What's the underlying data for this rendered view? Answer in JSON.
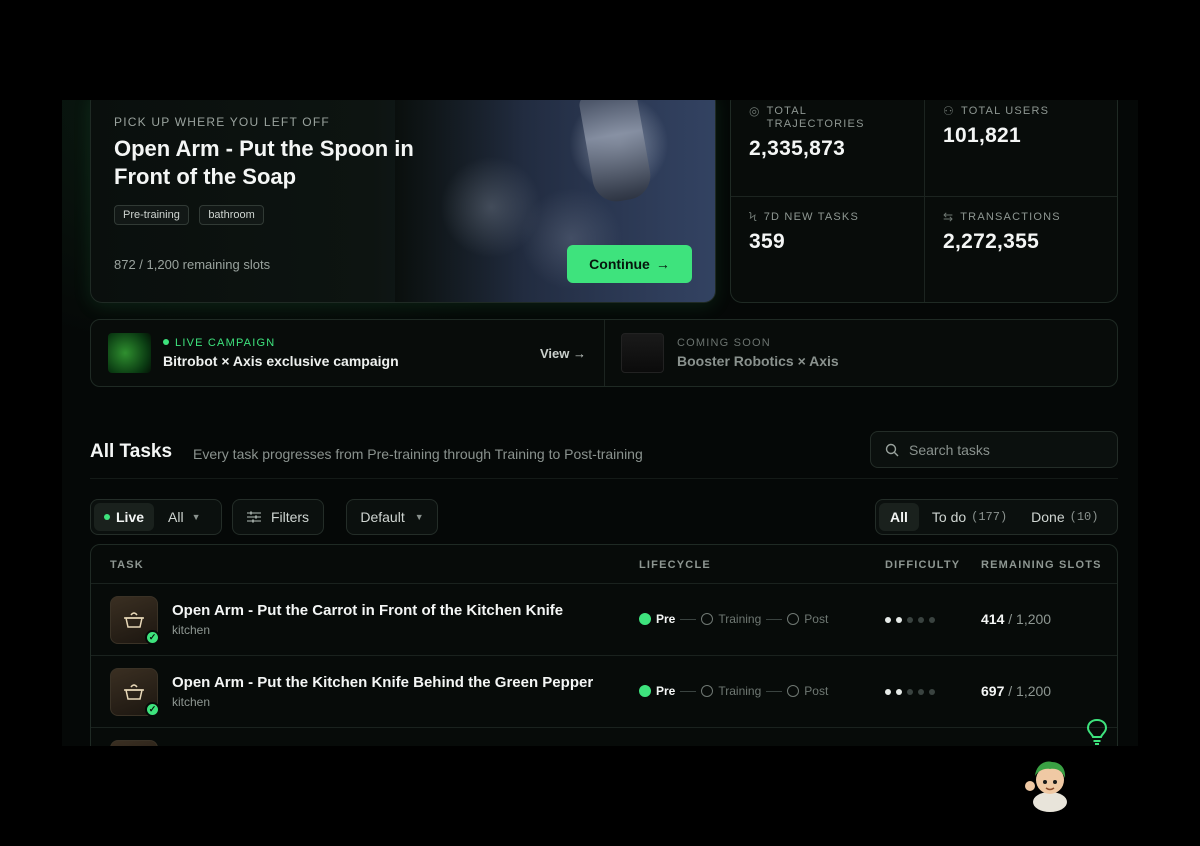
{
  "hero": {
    "kicker": "PICK UP WHERE YOU LEFT OFF",
    "title": "Open Arm - Put the Spoon in Front of the Soap",
    "tags": [
      "Pre-training",
      "bathroom"
    ],
    "slots": "872 / 1,200 remaining slots",
    "continue_label": "Continue",
    "continue_arrow": "→"
  },
  "stats": [
    {
      "icon": "target-icon",
      "glyph": "◎",
      "label": "TOTAL TRAJECTORIES",
      "value": "2,335,873"
    },
    {
      "icon": "users-icon",
      "glyph": "⚇",
      "label": "TOTAL USERS",
      "value": "101,821"
    },
    {
      "icon": "bolt-icon",
      "glyph": "ϟ",
      "label": "7D NEW TASKS",
      "value": "359"
    },
    {
      "icon": "swap-icon",
      "glyph": "⇆",
      "label": "TRANSACTIONS",
      "value": "2,272,355"
    }
  ],
  "campaigns": {
    "live": {
      "kicker": "LIVE CAMPAIGN",
      "title": "Bitrobot × Axis exclusive campaign",
      "view_label": "View →"
    },
    "soon": {
      "kicker": "COMING SOON",
      "title": "Booster Robotics × Axis"
    }
  },
  "tasks": {
    "title": "All Tasks",
    "subtitle": "Every task progresses from Pre-training through Training to Post-training",
    "search_placeholder": "Search tasks"
  },
  "filters": {
    "live_label": "Live",
    "scope_label": "All",
    "filters_label": "Filters",
    "sort_label": "Default",
    "tabs": [
      {
        "label": "All",
        "count": ""
      },
      {
        "label": "To do",
        "count": "(177)"
      },
      {
        "label": "Done",
        "count": "(10)"
      }
    ]
  },
  "table": {
    "headers": {
      "task": "TASK",
      "lifecycle": "LIFECYCLE",
      "difficulty": "DIFFICULTY",
      "slots": "REMAINING SLOTS"
    },
    "stages": [
      "Pre",
      "Training",
      "Post"
    ],
    "rows": [
      {
        "title": "Open Arm - Put the Carrot in Front of the Kitchen Knife",
        "category": "kitchen",
        "stage": 0,
        "difficulty": 2,
        "difficulty_max": 5,
        "remaining": "414",
        "total": " / 1,200"
      },
      {
        "title": "Open Arm - Put the Kitchen Knife Behind the Green Pepper",
        "category": "kitchen",
        "stage": 0,
        "difficulty": 2,
        "difficulty_max": 5,
        "remaining": "697",
        "total": " / 1,200"
      }
    ]
  },
  "colors": {
    "accent": "#3ee37d",
    "background": "#050807"
  }
}
